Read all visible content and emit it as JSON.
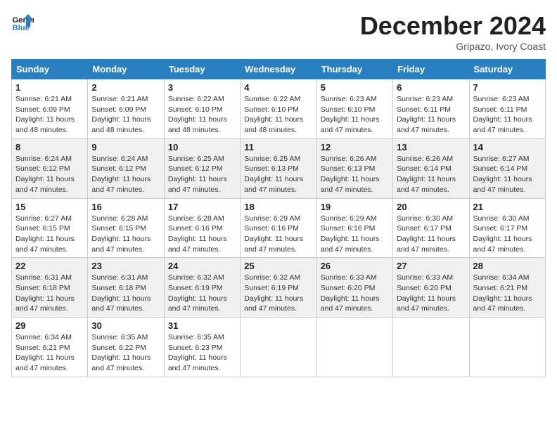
{
  "header": {
    "logo_line1": "General",
    "logo_line2": "Blue",
    "month_title": "December 2024",
    "location": "Gripazo, Ivory Coast"
  },
  "weekdays": [
    "Sunday",
    "Monday",
    "Tuesday",
    "Wednesday",
    "Thursday",
    "Friday",
    "Saturday"
  ],
  "weeks": [
    [
      {
        "day": "1",
        "info": "Sunrise: 6:21 AM\nSunset: 6:09 PM\nDaylight: 11 hours\nand 48 minutes."
      },
      {
        "day": "2",
        "info": "Sunrise: 6:21 AM\nSunset: 6:09 PM\nDaylight: 11 hours\nand 48 minutes."
      },
      {
        "day": "3",
        "info": "Sunrise: 6:22 AM\nSunset: 6:10 PM\nDaylight: 11 hours\nand 48 minutes."
      },
      {
        "day": "4",
        "info": "Sunrise: 6:22 AM\nSunset: 6:10 PM\nDaylight: 11 hours\nand 48 minutes."
      },
      {
        "day": "5",
        "info": "Sunrise: 6:23 AM\nSunset: 6:10 PM\nDaylight: 11 hours\nand 47 minutes."
      },
      {
        "day": "6",
        "info": "Sunrise: 6:23 AM\nSunset: 6:11 PM\nDaylight: 11 hours\nand 47 minutes."
      },
      {
        "day": "7",
        "info": "Sunrise: 6:23 AM\nSunset: 6:11 PM\nDaylight: 11 hours\nand 47 minutes."
      }
    ],
    [
      {
        "day": "8",
        "info": "Sunrise: 6:24 AM\nSunset: 6:12 PM\nDaylight: 11 hours\nand 47 minutes."
      },
      {
        "day": "9",
        "info": "Sunrise: 6:24 AM\nSunset: 6:12 PM\nDaylight: 11 hours\nand 47 minutes."
      },
      {
        "day": "10",
        "info": "Sunrise: 6:25 AM\nSunset: 6:12 PM\nDaylight: 11 hours\nand 47 minutes."
      },
      {
        "day": "11",
        "info": "Sunrise: 6:25 AM\nSunset: 6:13 PM\nDaylight: 11 hours\nand 47 minutes."
      },
      {
        "day": "12",
        "info": "Sunrise: 6:26 AM\nSunset: 6:13 PM\nDaylight: 11 hours\nand 47 minutes."
      },
      {
        "day": "13",
        "info": "Sunrise: 6:26 AM\nSunset: 6:14 PM\nDaylight: 11 hours\nand 47 minutes."
      },
      {
        "day": "14",
        "info": "Sunrise: 6:27 AM\nSunset: 6:14 PM\nDaylight: 11 hours\nand 47 minutes."
      }
    ],
    [
      {
        "day": "15",
        "info": "Sunrise: 6:27 AM\nSunset: 6:15 PM\nDaylight: 11 hours\nand 47 minutes."
      },
      {
        "day": "16",
        "info": "Sunrise: 6:28 AM\nSunset: 6:15 PM\nDaylight: 11 hours\nand 47 minutes."
      },
      {
        "day": "17",
        "info": "Sunrise: 6:28 AM\nSunset: 6:16 PM\nDaylight: 11 hours\nand 47 minutes."
      },
      {
        "day": "18",
        "info": "Sunrise: 6:29 AM\nSunset: 6:16 PM\nDaylight: 11 hours\nand 47 minutes."
      },
      {
        "day": "19",
        "info": "Sunrise: 6:29 AM\nSunset: 6:16 PM\nDaylight: 11 hours\nand 47 minutes."
      },
      {
        "day": "20",
        "info": "Sunrise: 6:30 AM\nSunset: 6:17 PM\nDaylight: 11 hours\nand 47 minutes."
      },
      {
        "day": "21",
        "info": "Sunrise: 6:30 AM\nSunset: 6:17 PM\nDaylight: 11 hours\nand 47 minutes."
      }
    ],
    [
      {
        "day": "22",
        "info": "Sunrise: 6:31 AM\nSunset: 6:18 PM\nDaylight: 11 hours\nand 47 minutes."
      },
      {
        "day": "23",
        "info": "Sunrise: 6:31 AM\nSunset: 6:18 PM\nDaylight: 11 hours\nand 47 minutes."
      },
      {
        "day": "24",
        "info": "Sunrise: 6:32 AM\nSunset: 6:19 PM\nDaylight: 11 hours\nand 47 minutes."
      },
      {
        "day": "25",
        "info": "Sunrise: 6:32 AM\nSunset: 6:19 PM\nDaylight: 11 hours\nand 47 minutes."
      },
      {
        "day": "26",
        "info": "Sunrise: 6:33 AM\nSunset: 6:20 PM\nDaylight: 11 hours\nand 47 minutes."
      },
      {
        "day": "27",
        "info": "Sunrise: 6:33 AM\nSunset: 6:20 PM\nDaylight: 11 hours\nand 47 minutes."
      },
      {
        "day": "28",
        "info": "Sunrise: 6:34 AM\nSunset: 6:21 PM\nDaylight: 11 hours\nand 47 minutes."
      }
    ],
    [
      {
        "day": "29",
        "info": "Sunrise: 6:34 AM\nSunset: 6:21 PM\nDaylight: 11 hours\nand 47 minutes."
      },
      {
        "day": "30",
        "info": "Sunrise: 6:35 AM\nSunset: 6:22 PM\nDaylight: 11 hours\nand 47 minutes."
      },
      {
        "day": "31",
        "info": "Sunrise: 6:35 AM\nSunset: 6:23 PM\nDaylight: 11 hours\nand 47 minutes."
      },
      null,
      null,
      null,
      null
    ]
  ]
}
